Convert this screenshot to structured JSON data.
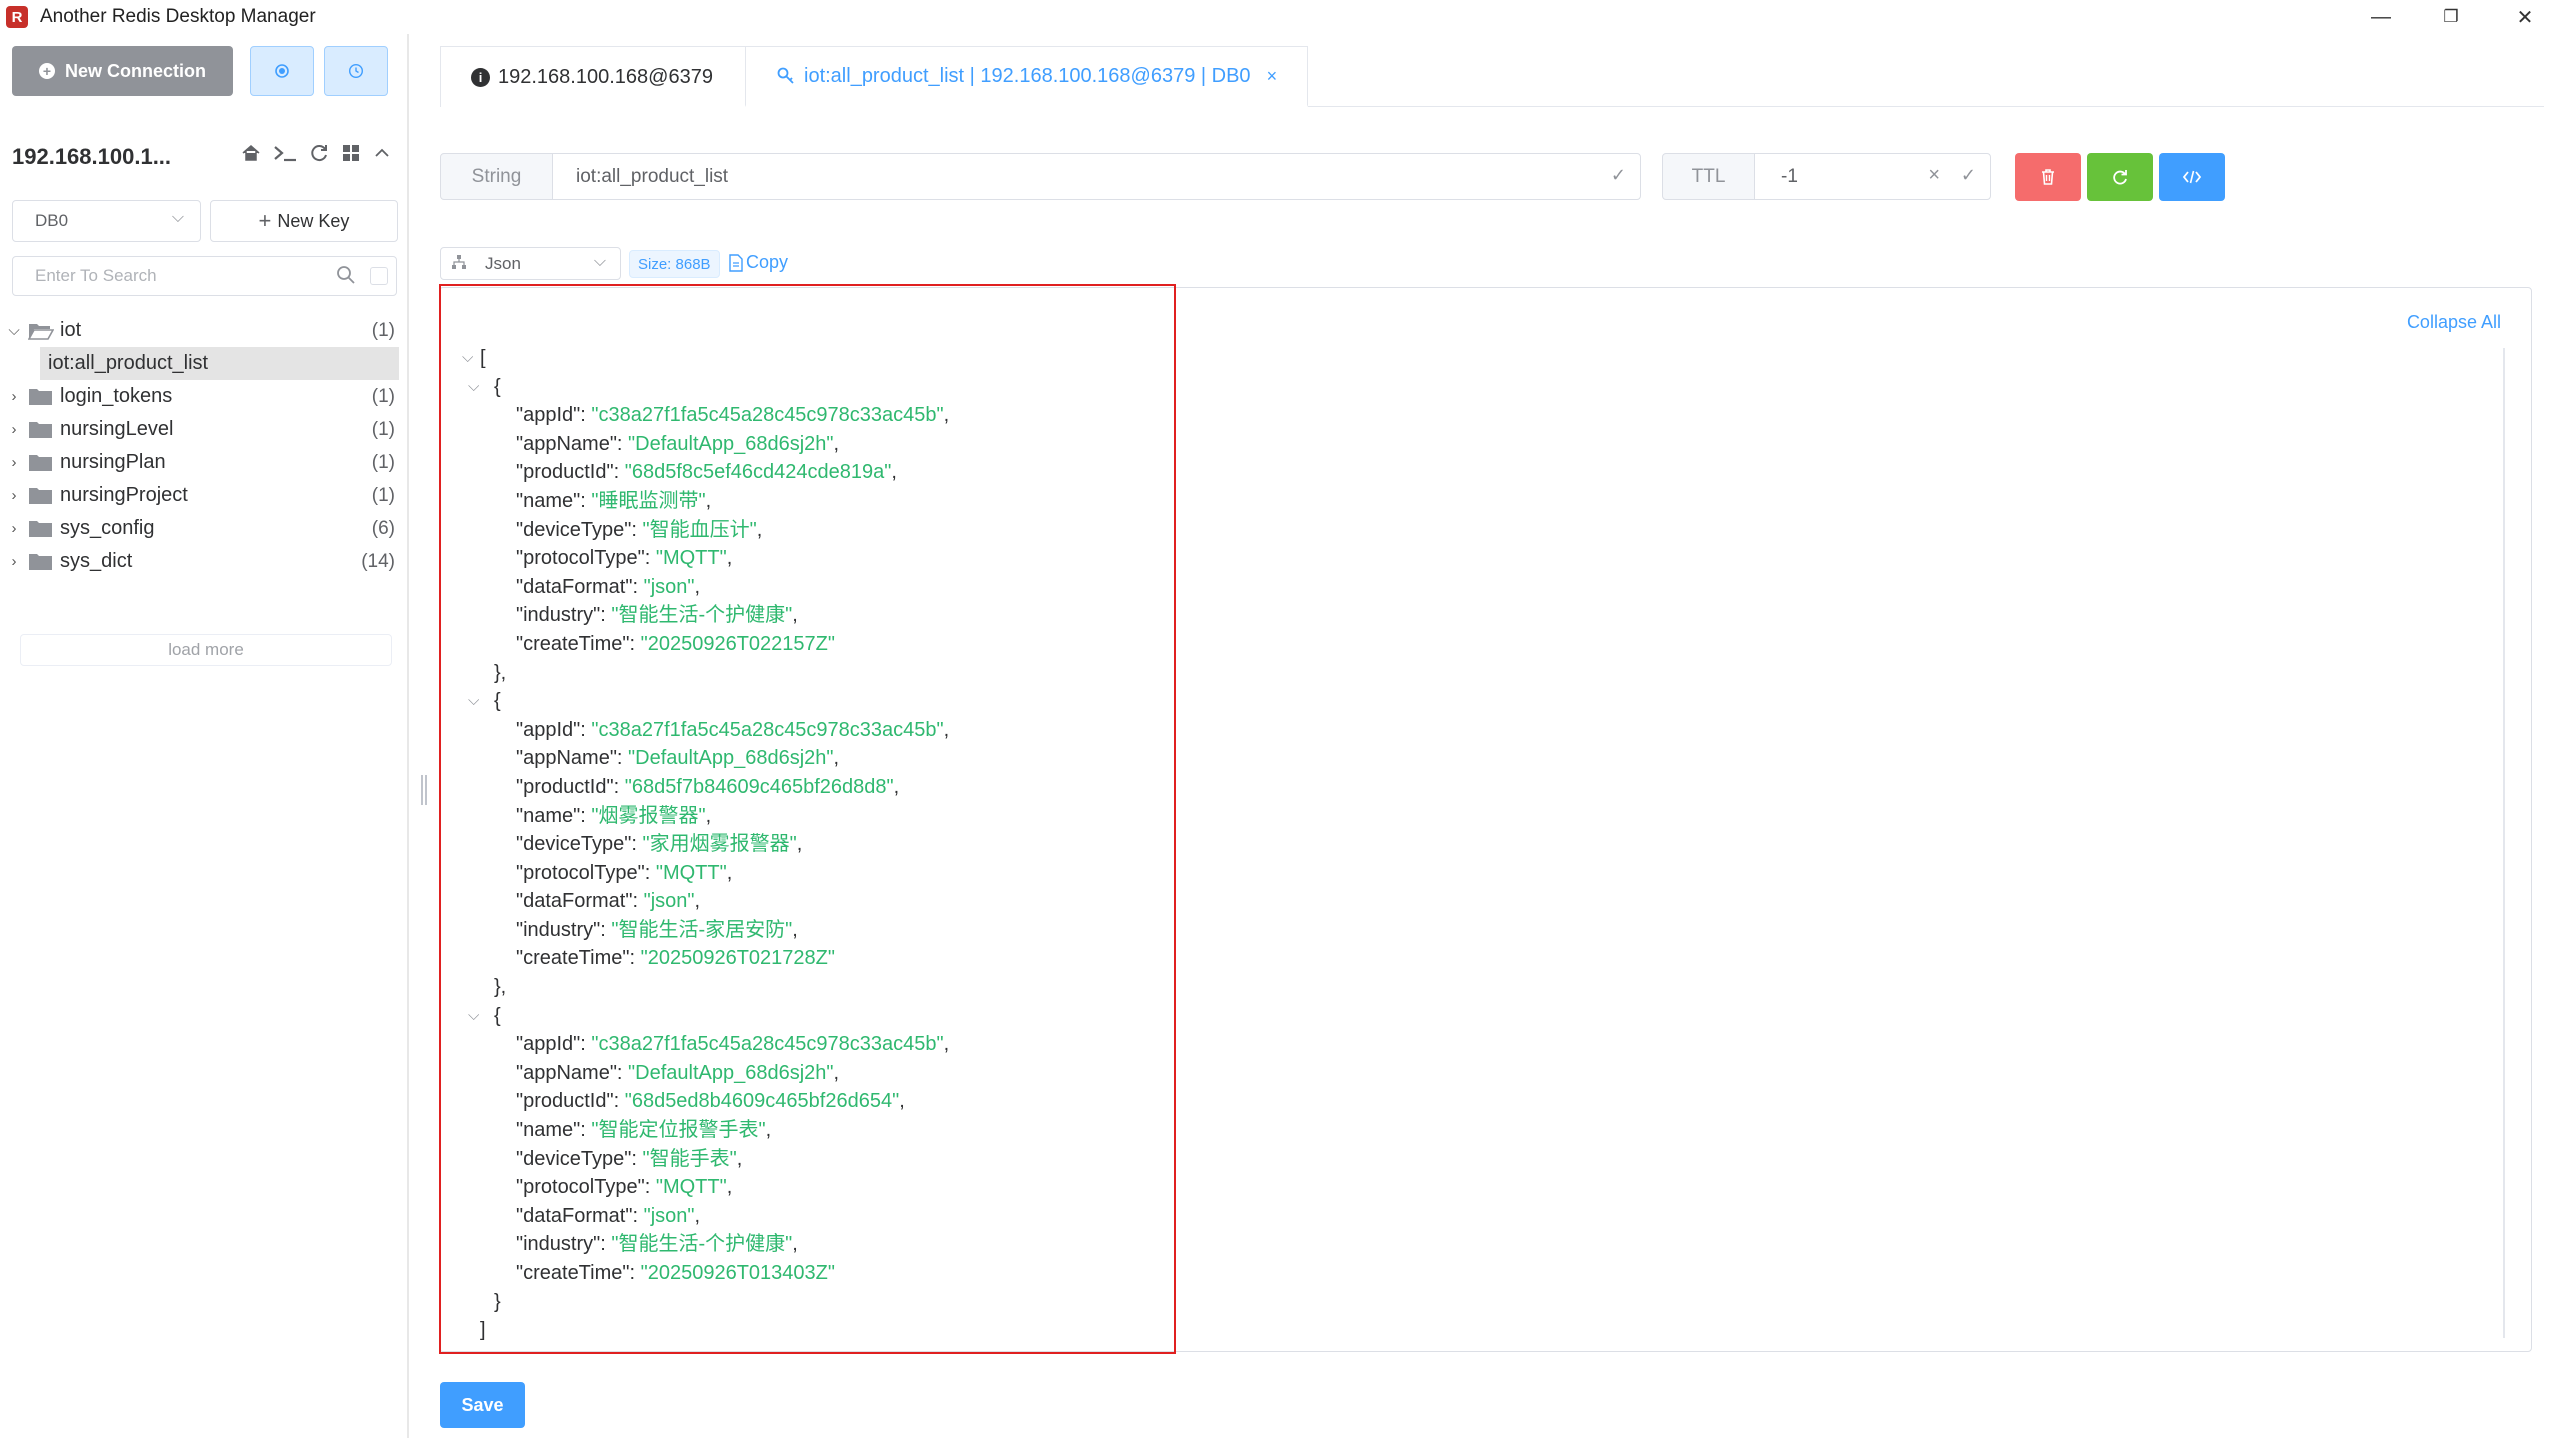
{
  "app": {
    "title": "Another Redis Desktop Manager",
    "logo_text": "R"
  },
  "window_controls": {
    "minimize": "—",
    "restore": "❐",
    "close": "✕"
  },
  "sidebar": {
    "new_connection_label": "New Connection",
    "connection_name": "192.168.100.1...",
    "db_select_value": "DB0",
    "new_key_label": "New Key",
    "search_placeholder": "Enter To Search",
    "tree": [
      {
        "label": "iot",
        "count": "(1)",
        "expanded": true,
        "children": [
          {
            "label": "iot:all_product_list",
            "selected": true
          }
        ]
      },
      {
        "label": "login_tokens",
        "count": "(1)"
      },
      {
        "label": "nursingLevel",
        "count": "(1)"
      },
      {
        "label": "nursingPlan",
        "count": "(1)"
      },
      {
        "label": "nursingProject",
        "count": "(1)"
      },
      {
        "label": "sys_config",
        "count": "(6)"
      },
      {
        "label": "sys_dict",
        "count": "(14)"
      }
    ],
    "load_more_label": "load more"
  },
  "tabs": [
    {
      "label": "192.168.100.168@6379",
      "active": false
    },
    {
      "label": "iot:all_product_list | 192.168.100.168@6379 | DB0",
      "active": true
    }
  ],
  "key_editor": {
    "type_label": "String",
    "key_name": "iot:all_product_list",
    "ttl_label": "TTL",
    "ttl_value": "-1",
    "format_value": "Json",
    "size_label": "Size: 868B",
    "copy_label": "Copy",
    "collapse_all_label": "Collapse All",
    "save_label": "Save"
  },
  "colors": {
    "accent": "#409eff",
    "danger": "#f56c6c",
    "success": "#67c23a",
    "json_string": "#2fb86f",
    "highlight_box": "#e02020"
  },
  "json_records": [
    {
      "appId": "c38a27f1fa5c45a28c45c978c33ac45b",
      "appName": "DefaultApp_68d6sj2h",
      "productId": "68d5f8c5ef46cd424cde819a",
      "name": "睡眠监测带",
      "deviceType": "智能血压计",
      "protocolType": "MQTT",
      "dataFormat": "json",
      "industry": "智能生活-个护健康",
      "createTime": "20250926T022157Z"
    },
    {
      "appId": "c38a27f1fa5c45a28c45c978c33ac45b",
      "appName": "DefaultApp_68d6sj2h",
      "productId": "68d5f7b84609c465bf26d8d8",
      "name": "烟雾报警器",
      "deviceType": "家用烟雾报警器",
      "protocolType": "MQTT",
      "dataFormat": "json",
      "industry": "智能生活-家居安防",
      "createTime": "20250926T021728Z"
    },
    {
      "appId": "c38a27f1fa5c45a28c45c978c33ac45b",
      "appName": "DefaultApp_68d6sj2h",
      "productId": "68d5ed8b4609c465bf26d654",
      "name": "智能定位报警手表",
      "deviceType": "智能手表",
      "protocolType": "MQTT",
      "dataFormat": "json",
      "industry": "智能生活-个护健康",
      "createTime": "20250926T013403Z"
    }
  ]
}
